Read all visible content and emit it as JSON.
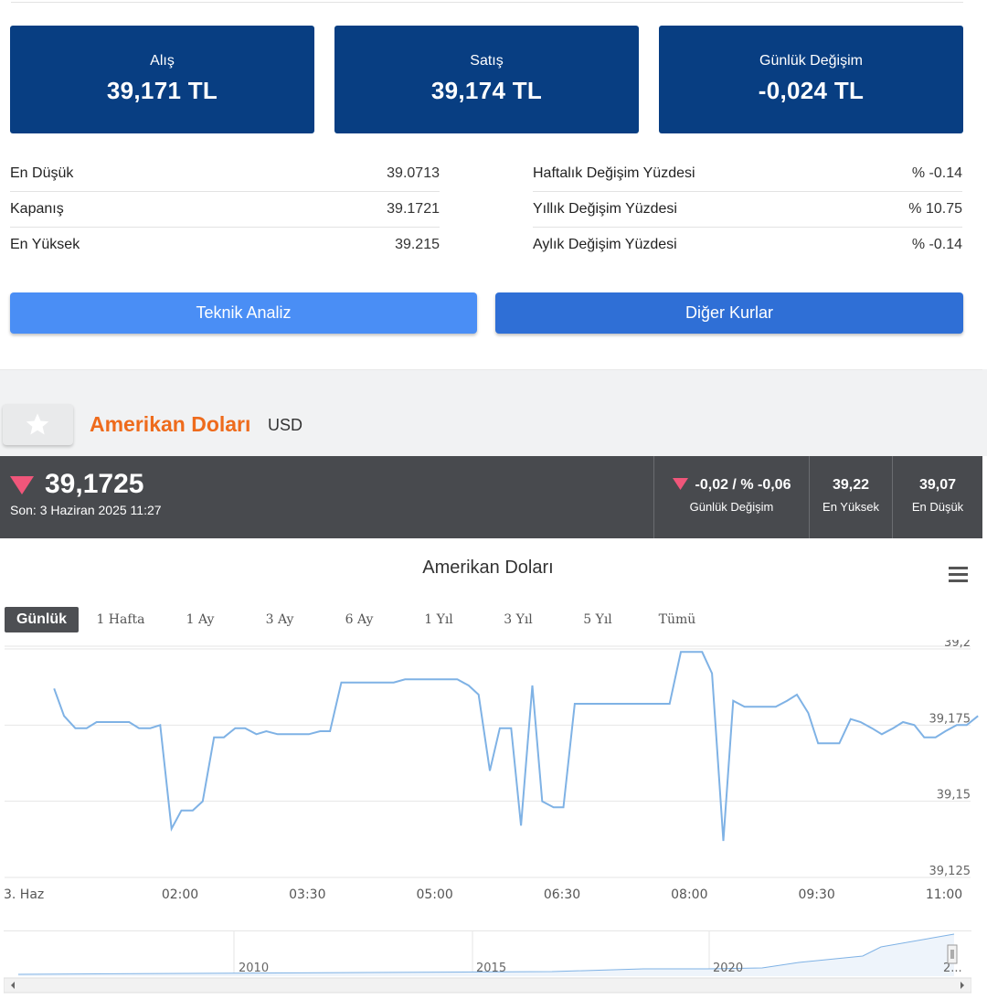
{
  "cards": [
    {
      "label": "Alış",
      "value": "39,171 TL"
    },
    {
      "label": "Satış",
      "value": "39,174 TL"
    },
    {
      "label": "Günlük Değişim",
      "value": "-0,024 TL"
    }
  ],
  "stats_left": [
    {
      "label": "En Düşük",
      "value": "39.0713"
    },
    {
      "label": "Kapanış",
      "value": "39.1721"
    },
    {
      "label": "En Yüksek",
      "value": "39.215"
    }
  ],
  "stats_right": [
    {
      "label": "Haftalık Değişim Yüzdesi",
      "value": "% -0.14"
    },
    {
      "label": "Yıllık Değişim Yüzdesi",
      "value": "% 10.75"
    },
    {
      "label": "Aylık Değişim Yüzdesi",
      "value": "% -0.14"
    }
  ],
  "buttons": {
    "technical": "Teknik Analiz",
    "other": "Diğer Kurlar"
  },
  "currency": {
    "name": "Amerikan Doları",
    "code": "USD"
  },
  "ticker": {
    "price": "39,1725",
    "last_update": "Son: 3 Haziran 2025 11:27",
    "change": "-0,02 / % -0,06",
    "change_label": "Günlük Değişim",
    "high": "39,22",
    "high_label": "En Yüksek",
    "low": "39,07",
    "low_label": "En Düşük"
  },
  "colors": {
    "card_bg": "#083e82",
    "btn_light": "#4a8ef5",
    "btn_dark": "#2f6fd6",
    "accent_orange": "#ee6b1c",
    "down_red": "#f0567a",
    "line": "#7fb2e5"
  },
  "icons": {
    "favorite": "star-icon",
    "menu": "hamburger-menu-icon",
    "down": "down-triangle-icon"
  },
  "chart": {
    "title": "Amerikan Doları",
    "ranges": [
      "Günlük",
      "1 Hafta",
      "1 Ay",
      "3 Ay",
      "6 Ay",
      "1 Yıl",
      "3 Yıl",
      "5 Yıl",
      "Tümü"
    ],
    "active_range": "Günlük",
    "navigator_labels": [
      "2010",
      "2015",
      "2020",
      "2..."
    ]
  },
  "chart_data": {
    "type": "line",
    "title": "Amerikan Doları",
    "x_tick_labels": [
      "3. Haz",
      "02:00",
      "03:30",
      "05:00",
      "06:30",
      "08:00",
      "09:30",
      "11:00"
    ],
    "y_tick_labels": [
      "39,2",
      "39,175",
      "39,15",
      "39,125"
    ],
    "ylim": [
      39.125,
      39.2
    ],
    "grid": true,
    "legend": "none",
    "series": [
      {
        "x": [
          "00:31",
          "00:38",
          "00:46",
          "00:54",
          "01:01",
          "01:09",
          "01:16",
          "01:24",
          "01:31",
          "01:39",
          "01:46",
          "01:54",
          "02:01",
          "02:09",
          "02:16",
          "02:24",
          "02:31",
          "02:39",
          "02:46",
          "02:54",
          "03:01",
          "03:09",
          "03:16",
          "03:24",
          "03:31",
          "03:39",
          "03:46",
          "03:54",
          "04:01",
          "04:09",
          "04:16",
          "04:24",
          "04:31",
          "04:39",
          "04:46",
          "04:54",
          "05:01",
          "05:09",
          "05:16",
          "05:24",
          "05:31",
          "05:39",
          "05:46",
          "05:54",
          "06:01",
          "06:09",
          "06:16",
          "06:24",
          "06:31",
          "06:39",
          "06:46",
          "06:54",
          "07:01",
          "07:09",
          "07:16",
          "07:24",
          "07:31",
          "07:39",
          "07:46",
          "07:54",
          "08:01",
          "08:09",
          "08:16",
          "08:24",
          "08:31",
          "08:39",
          "08:46",
          "08:54",
          "09:01",
          "09:09",
          "09:16",
          "09:24",
          "09:31",
          "09:39",
          "09:46",
          "09:54",
          "10:01",
          "10:09",
          "10:16",
          "10:24",
          "10:31",
          "10:39",
          "10:46",
          "10:54",
          "11:01",
          "11:09",
          "11:16",
          "11:24"
        ],
        "values": [
          39.187,
          39.178,
          39.174,
          39.174,
          39.176,
          39.176,
          39.176,
          39.176,
          39.174,
          39.174,
          39.175,
          39.141,
          39.147,
          39.147,
          39.15,
          39.171,
          39.171,
          39.174,
          39.174,
          39.172,
          39.173,
          39.172,
          39.172,
          39.172,
          39.172,
          39.173,
          39.173,
          39.189,
          39.189,
          39.189,
          39.189,
          39.189,
          39.189,
          39.19,
          39.19,
          39.19,
          39.19,
          39.19,
          39.19,
          39.188,
          39.185,
          39.16,
          39.174,
          39.174,
          39.142,
          39.188,
          39.15,
          39.148,
          39.148,
          39.182,
          39.182,
          39.182,
          39.182,
          39.182,
          39.182,
          39.182,
          39.182,
          39.182,
          39.182,
          39.199,
          39.199,
          39.199,
          39.192,
          39.137,
          39.183,
          39.181,
          39.181,
          39.181,
          39.181,
          39.183,
          39.185,
          39.179,
          39.169,
          39.169,
          39.169,
          39.177,
          39.176,
          39.174,
          39.172,
          39.174,
          39.176,
          39.175,
          39.171,
          39.171,
          39.173,
          39.175,
          39.175,
          39.178
        ]
      }
    ]
  }
}
